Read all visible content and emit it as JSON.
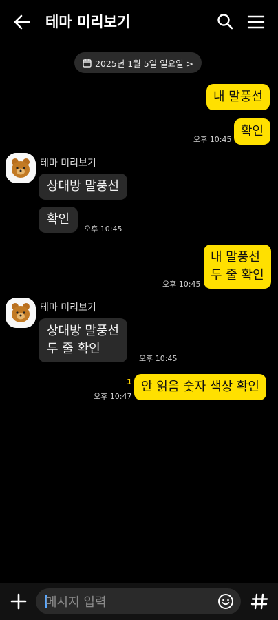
{
  "header": {
    "title": "테마 미리보기"
  },
  "date_separator": "2025년 1월 5일 일요일 >",
  "sender_name": "테마 미리보기",
  "messages": {
    "m1": {
      "text": "내 말풍선"
    },
    "m2": {
      "text": "확인",
      "time": "오후 10:45"
    },
    "m3": {
      "text": "상대방 말풍선"
    },
    "m4": {
      "text": "확인",
      "time": "오후 10:45"
    },
    "m5": {
      "text": "내 말풍선\n두 줄 확인",
      "time": "오후 10:45"
    },
    "m6": {
      "text": "상대방 말풍선\n두 줄 확인",
      "time": "오후 10:45"
    },
    "m7": {
      "text": "안 읽음 숫자 색상 확인",
      "time": "오후 10:47",
      "unread": "1"
    }
  },
  "input": {
    "placeholder": "메시지 입력"
  },
  "colors": {
    "my_bubble": "#ffe000",
    "other_bubble": "#2a2a2a",
    "unread_count": "#ffd400",
    "background": "#000000"
  },
  "icons": [
    "back-arrow-icon",
    "search-icon",
    "hamburger-menu-icon",
    "calendar-icon",
    "plus-icon",
    "emoji-icon",
    "hash-icon"
  ]
}
